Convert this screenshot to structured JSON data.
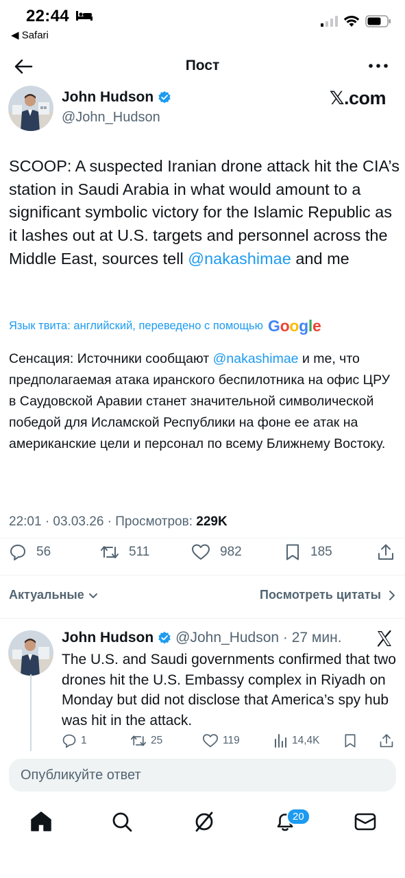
{
  "status_bar": {
    "time": "22:44",
    "back_app": "◀ Safari"
  },
  "nav": {
    "title": "Пост"
  },
  "author": {
    "name": "John Hudson",
    "handle": "@John_Hudson",
    "source_badge": "𝕏.com"
  },
  "tweet": {
    "text_before": "SCOOP: A suspected Iranian drone attack hit the CIA’s station in Saudi Arabia in what would amount to a significant symbolic victory for the Islamic Republic as it lashes out at U.S. targets and personnel across the Middle East, sources tell ",
    "mention": "@nakashimae",
    "text_after": " and me",
    "translation_label": "Язык твита: английский, переведено с помощью",
    "translation_provider": "Google",
    "translated_before": "Сенсация: Источники сообщают ",
    "translated_mention": "@nakashimae",
    "translated_after": " и me, что предполагаемая атака иранского беспилотника на офис ЦРУ в Саудовской Аравии станет значительной символической победой для Исламской Республики на фоне ее атак на американские цели и персонал по всему Ближнему Востоку.",
    "meta_time": "22:01 · 03.03.26 · Просмотров: ",
    "views": "229K",
    "replies": "56",
    "retweets": "511",
    "likes": "982",
    "bookmarks": "185"
  },
  "filters": {
    "left": "Актуальные",
    "right": "Посмотреть цитаты"
  },
  "reply": {
    "name": "John Hudson",
    "handle_time": "@John_Hudson · 27 мин.",
    "text": "The U.S. and Saudi governments confirmed that two drones hit the U.S. Embassy complex in Riyadh on Monday but did not disclose that America’s spy hub was hit in the attack.",
    "replies": "1",
    "retweets": "25",
    "likes": "119",
    "views": "14,4K"
  },
  "composer": {
    "placeholder": "Опубликуйте ответ"
  },
  "tabbar": {
    "notifications_badge": "20"
  },
  "colors": {
    "accent": "#1d9bf0",
    "text": "#0f1419",
    "muted": "#536471"
  }
}
